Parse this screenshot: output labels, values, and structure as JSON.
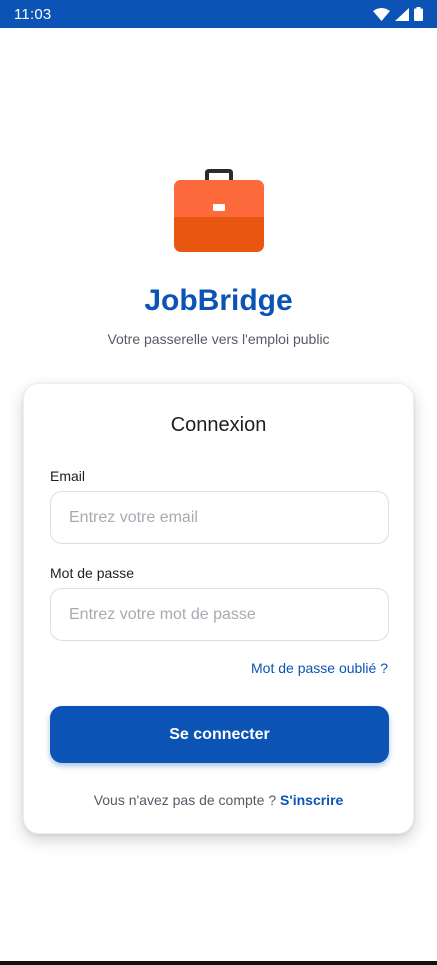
{
  "status_bar": {
    "time": "11:03",
    "icons": [
      "wifi-icon",
      "signal-icon",
      "battery-icon"
    ],
    "color": "#0b53b5"
  },
  "app": {
    "logo_icon": "briefcase-icon",
    "title": "JobBridge",
    "subtitle": "Votre passerelle vers l'emploi public"
  },
  "login_card": {
    "title": "Connexion",
    "email": {
      "label": "Email",
      "value": "",
      "placeholder": "Entrez votre email"
    },
    "password": {
      "label": "Mot de passe",
      "value": "",
      "placeholder": "Entrez votre mot de passe"
    },
    "forgot_password": "Mot de passe oublié ?",
    "submit_label": "Se connecter",
    "signup_prompt": "Vous n'avez pas de compte ? ",
    "signup_link": "S'inscrire"
  },
  "colors": {
    "primary": "#0b53b5",
    "logo_orange": "#e8560f",
    "logo_orange_light": "#fd6b3c"
  }
}
